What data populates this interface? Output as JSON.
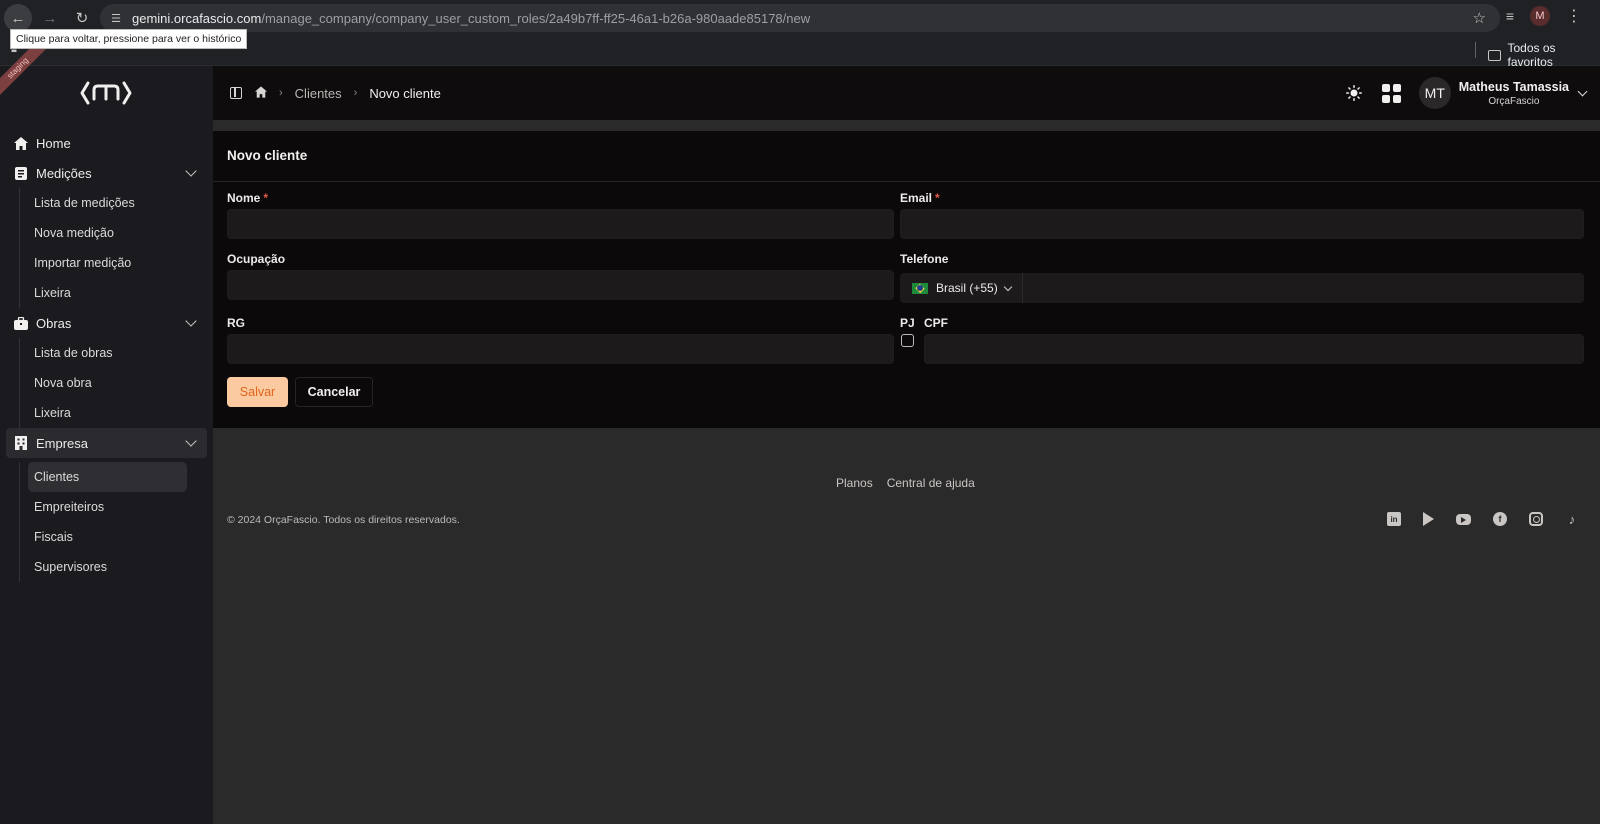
{
  "browser": {
    "url_host": "gemini.orcafascio.com",
    "url_path": "/manage_company/company_user_custom_roles/2a49b7ff-ff25-46a1-b26a-980aade85178/new",
    "tooltip": "Clique para voltar, pressione para ver o histórico",
    "bookmark_folder": "Todos os favoritos",
    "profile_initial": "M"
  },
  "sidebar": {
    "env_badge": "staging",
    "items": [
      {
        "label": "Home",
        "icon": "home-icon"
      },
      {
        "label": "Medições",
        "icon": "clipboard-icon",
        "children": [
          "Lista de medições",
          "Nova medição",
          "Importar medição",
          "Lixeira"
        ]
      },
      {
        "label": "Obras",
        "icon": "briefcase-icon",
        "children": [
          "Lista de obras",
          "Nova obra",
          "Lixeira"
        ]
      },
      {
        "label": "Empresa",
        "icon": "building-icon",
        "children": [
          "Clientes",
          "Empreiteiros",
          "Fiscais",
          "Supervisores"
        ]
      }
    ]
  },
  "topbar": {
    "breadcrumb": [
      "Clientes",
      "Novo cliente"
    ],
    "user": {
      "initials": "MT",
      "name": "Matheus Tamassia",
      "company": "OrçaFascio"
    }
  },
  "form": {
    "title": "Novo cliente",
    "fields": {
      "nome": {
        "label": "Nome",
        "required": "*",
        "value": ""
      },
      "email": {
        "label": "Email",
        "required": "*",
        "value": ""
      },
      "ocupacao": {
        "label": "Ocupação",
        "value": ""
      },
      "telefone": {
        "label": "Telefone",
        "country": "Brasil (+55)",
        "value": ""
      },
      "rg": {
        "label": "RG",
        "value": ""
      },
      "pj": {
        "label": "PJ",
        "checked": false
      },
      "cpf": {
        "label": "CPF",
        "value": ""
      }
    },
    "save_label": "Salvar",
    "cancel_label": "Cancelar"
  },
  "footer": {
    "links": [
      "Planos",
      "Central de ajuda"
    ],
    "copyright": "© 2024 OrçaFascio. Todos os direitos reservados.",
    "socials": [
      "linkedin-icon",
      "google-play-icon",
      "youtube-icon",
      "facebook-icon",
      "instagram-icon",
      "tiktok-icon"
    ]
  },
  "colors": {
    "accent": "#fbcaa0",
    "accent_text": "#e0651d",
    "required": "#e35a4a",
    "sidebar_bg": "#1b1a1f",
    "card_bg": "#0b0909",
    "page_bg": "#2b2a2a"
  }
}
